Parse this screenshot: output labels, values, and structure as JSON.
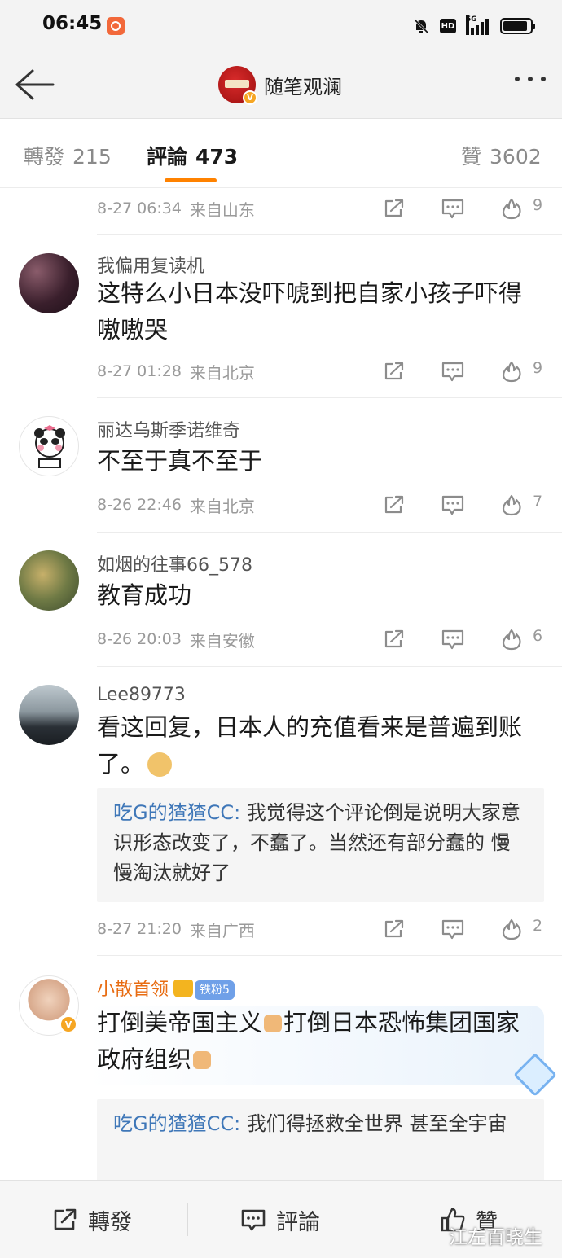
{
  "status_bar": {
    "time": "06:45",
    "network": "5G",
    "hd": "HD",
    "battery_level": 0.9
  },
  "nav": {
    "title": "随笔观澜",
    "avatar_text": "随笔观澜"
  },
  "tabs": [
    {
      "label": "轉發",
      "count": "215"
    },
    {
      "label": "評論",
      "count": "473"
    },
    {
      "label": "贊",
      "count": "3602"
    }
  ],
  "comments": [
    {
      "time": "8-27 06:34",
      "location": "来自山东",
      "likes": "9"
    },
    {
      "user": "我偏用复读机",
      "text": "这特么小日本没吓唬到把自家小孩子吓得嗷嗷哭",
      "time": "8-27 01:28",
      "location": "来自北京",
      "likes": "9"
    },
    {
      "user": "丽达乌斯季诺维奇",
      "text": "不至于真不至于",
      "time": "8-26 22:46",
      "location": "来自北京",
      "likes": "7"
    },
    {
      "user": "如烟的往事66_578",
      "text": "教育成功",
      "time": "8-26 20:03",
      "location": "来自安徽",
      "likes": "6"
    },
    {
      "user": "Lee89773",
      "text": "看这回复，日本人的充值看来是普遍到账了。",
      "quote_user": "吃G的猹猹CC",
      "quote_text": "我觉得这个评论倒是说明大家意识形态改变了，不蠢了。当然还有部分蠢的 慢慢淘汰就好了",
      "time": "8-27 21:20",
      "location": "来自广西",
      "likes": "2"
    },
    {
      "user": "小散首领",
      "fan_badge": "铁粉5",
      "text_part1": "打倒美帝国主义",
      "text_part2": "打倒日本恐怖集团国家政府组织",
      "quote_user": "吃G的猹猹CC",
      "quote_text": "我们得拯救全世界 甚至全宇宙"
    }
  ],
  "bottom_bar": {
    "repost": "轉發",
    "comment": "評論",
    "like": "贊"
  },
  "watermark": "江左百晓生",
  "colors": {
    "accent": "#ff8200",
    "quote_link": "#3f77b8",
    "orange_name": "#e86c12"
  }
}
